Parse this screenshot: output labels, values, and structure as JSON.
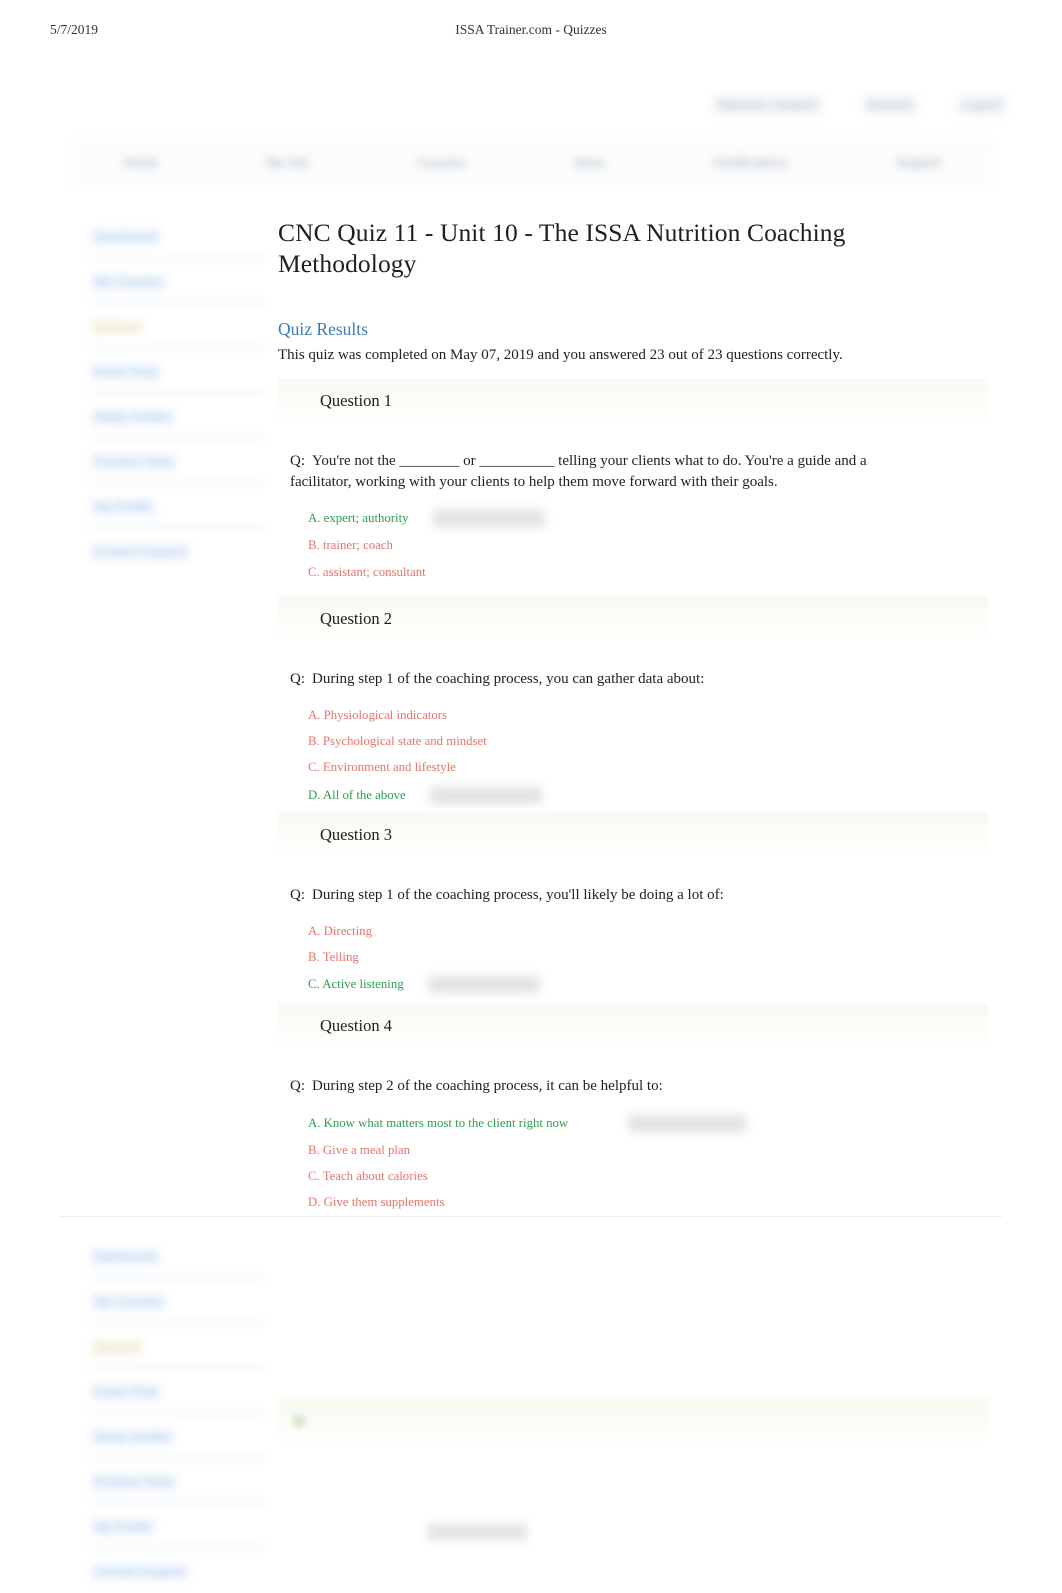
{
  "print_header": {
    "date": "5/7/2019",
    "title": "ISSA Trainer.com - Quizzes"
  },
  "chrome": {
    "utility_items": [
      {
        "label": "Welcome, Student",
        "name": "welcome-user-link"
      },
      {
        "label": "Account",
        "name": "account-link"
      },
      {
        "label": "Logout",
        "name": "logout-link"
      }
    ],
    "nav_tabs": [
      {
        "label": "Home"
      },
      {
        "label": "My Info"
      },
      {
        "label": "Courses"
      },
      {
        "label": "Store"
      },
      {
        "label": "Certifications"
      },
      {
        "label": "Support"
      }
    ]
  },
  "sidebar": {
    "items": [
      {
        "label": "Dashboard"
      },
      {
        "label": "My Courses"
      },
      {
        "label": "Quizzes"
      },
      {
        "label": "Exam Prep"
      },
      {
        "label": "Study Guides"
      },
      {
        "label": "Practice Tests"
      },
      {
        "label": "My Profile"
      },
      {
        "label": "Contact Support"
      }
    ]
  },
  "main": {
    "quiz_title": "CNC Quiz 11 - Unit 10 - The ISSA Nutrition Coaching Methodology",
    "results_heading": "Quiz Results",
    "results_text": "This quiz was completed on May 07, 2019 and you answered 23 out of 23 questions correctly.",
    "answer_prefix": "Q:",
    "questions": [
      {
        "label": "Question 1",
        "text": "You're not the ________ or __________ telling your clients what to do. You're a guide and a facilitator, working with your clients to help them move forward with their goals.",
        "answers": [
          {
            "label": "A. expert; authority",
            "state": "correct",
            "badge": true
          },
          {
            "label": "B. trainer; coach",
            "state": "incorrect",
            "badge": false
          },
          {
            "label": "C. assistant; consultant",
            "state": "incorrect",
            "badge": false
          }
        ]
      },
      {
        "label": "Question 2",
        "text": "During step 1 of the coaching process, you can gather data about:",
        "answers": [
          {
            "label": "A. Physiological indicators",
            "state": "incorrect",
            "badge": false
          },
          {
            "label": "B. Psychological state and mindset",
            "state": "incorrect",
            "badge": false
          },
          {
            "label": "C. Environment and lifestyle",
            "state": "incorrect",
            "badge": false
          },
          {
            "label": "D. All of the above",
            "state": "correct",
            "badge": true
          }
        ]
      },
      {
        "label": "Question 3",
        "text": "During step 1 of the coaching process, you'll likely be doing a lot of:",
        "answers": [
          {
            "label": "A. Directing",
            "state": "incorrect",
            "badge": false
          },
          {
            "label": "B. Telling",
            "state": "incorrect",
            "badge": false
          },
          {
            "label": "C. Active listening",
            "state": "correct",
            "badge": true
          }
        ]
      },
      {
        "label": "Question 4",
        "text": "During step 2 of the coaching process, it can be helpful to:",
        "answers": [
          {
            "label": "A. Know what matters most to the client right now",
            "state": "correct",
            "badge": true
          },
          {
            "label": "B. Give a meal plan",
            "state": "incorrect",
            "badge": false
          },
          {
            "label": "C. Teach about calories",
            "state": "incorrect",
            "badge": false
          },
          {
            "label": "D. Give them supplements",
            "state": "incorrect",
            "badge": false
          }
        ]
      }
    ]
  },
  "colors": {
    "correct": "#2e9e4f",
    "incorrect": "#e8736a",
    "heading_link": "#3a7cb8",
    "question_header_bg": "#f7faf3"
  }
}
